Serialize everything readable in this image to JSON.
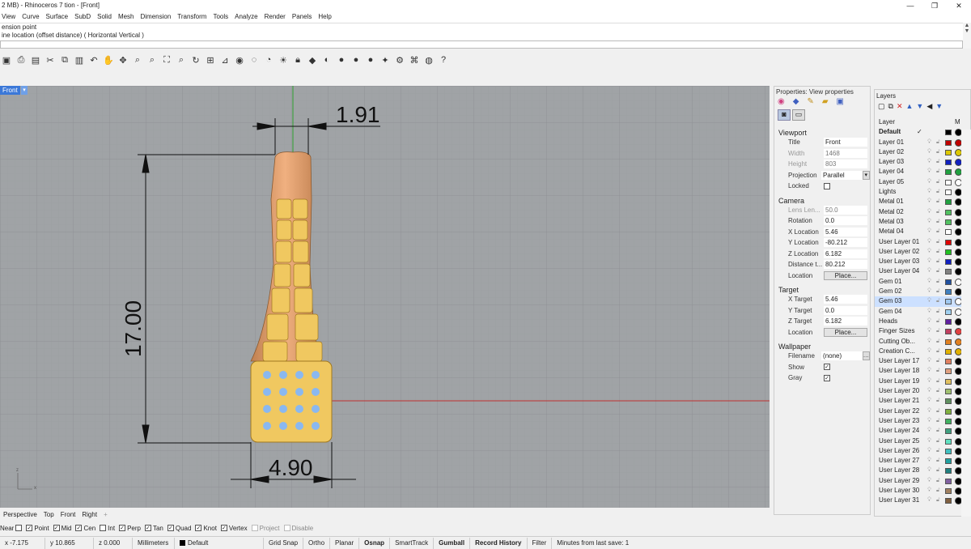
{
  "window": {
    "title": "2 MB) - Rhinoceros 7 tion - [Front]"
  },
  "menu": [
    "View",
    "Curve",
    "Surface",
    "SubD",
    "Solid",
    "Mesh",
    "Dimension",
    "Transform",
    "Tools",
    "Analyze",
    "Render",
    "Panels",
    "Help"
  ],
  "command": {
    "history": [
      "ension point",
      "ine location (offset distance) ( Horizontal  Vertical )"
    ],
    "prompt": ""
  },
  "viewport": {
    "name": "Front",
    "dims": {
      "top": "1.91",
      "height": "17.00",
      "bottom": "4.90"
    }
  },
  "viewport_tabs": [
    "Perspective",
    "Top",
    "Front",
    "Right"
  ],
  "osnap": [
    {
      "label": "Near",
      "checked": false
    },
    {
      "label": "Point",
      "checked": true
    },
    {
      "label": "Mid",
      "checked": true
    },
    {
      "label": "Cen",
      "checked": true
    },
    {
      "label": "Int",
      "checked": false
    },
    {
      "label": "Perp",
      "checked": true
    },
    {
      "label": "Tan",
      "checked": true
    },
    {
      "label": "Quad",
      "checked": true
    },
    {
      "label": "Knot",
      "checked": true
    },
    {
      "label": "Vertex",
      "checked": true
    },
    {
      "label": "Project",
      "checked": false
    },
    {
      "label": "Disable",
      "checked": false
    }
  ],
  "status": {
    "x": "x -7.175",
    "y": "y 10.865",
    "z": "z 0.000",
    "units": "Millimeters",
    "layer": "Default",
    "toggles": [
      "Grid Snap",
      "Ortho",
      "Planar",
      "Osnap",
      "SmartTrack",
      "Gumball",
      "Record History",
      "Filter"
    ],
    "bold_toggles": [
      "Osnap",
      "Gumball",
      "Record History"
    ],
    "save": "Minutes from last save: 1"
  },
  "properties": {
    "title": "Properties: View properties",
    "sections": {
      "viewport": {
        "heading": "Viewport",
        "rows": [
          {
            "label": "Title",
            "value": "Front"
          },
          {
            "label": "Width",
            "value": "1468",
            "grey": true
          },
          {
            "label": "Height",
            "value": "803",
            "grey": true
          },
          {
            "label": "Projection",
            "value": "Parallel"
          },
          {
            "label": "Locked",
            "value": ""
          }
        ]
      },
      "camera": {
        "heading": "Camera",
        "rows": [
          {
            "label": "Lens Len...",
            "value": "50.0",
            "grey": true
          },
          {
            "label": "Rotation",
            "value": "0.0"
          },
          {
            "label": "X Location",
            "value": "5.46"
          },
          {
            "label": "Y Location",
            "value": "-80.212"
          },
          {
            "label": "Z Location",
            "value": "6.182"
          },
          {
            "label": "Distance t...",
            "value": "80.212"
          },
          {
            "label": "Location",
            "value": "Place...",
            "button": true
          }
        ]
      },
      "target": {
        "heading": "Target",
        "rows": [
          {
            "label": "X Target",
            "value": "5.46"
          },
          {
            "label": "Y Target",
            "value": "0.0"
          },
          {
            "label": "Z Target",
            "value": "6.182"
          },
          {
            "label": "Location",
            "value": "Place...",
            "button": true
          }
        ]
      },
      "wallpaper": {
        "heading": "Wallpaper",
        "rows": [
          {
            "label": "Filename",
            "value": "(none)"
          },
          {
            "label": "Show",
            "value": "✓"
          },
          {
            "label": "Gray",
            "value": "✓"
          }
        ]
      }
    }
  },
  "layers": {
    "title": "Layers",
    "header": "Layer",
    "items": [
      {
        "name": "Default",
        "color": "#000000",
        "mat": "#000000",
        "bold": true,
        "current": true
      },
      {
        "name": "Layer 01",
        "color": "#c00000",
        "mat": "#c00000"
      },
      {
        "name": "Layer 02",
        "color": "#ddc800",
        "mat": "#ddc800"
      },
      {
        "name": "Layer 03",
        "color": "#1020c0",
        "mat": "#1020c0"
      },
      {
        "name": "Layer 04",
        "color": "#20a040",
        "mat": "#20a040"
      },
      {
        "name": "Layer 05",
        "color": "#ffffff",
        "mat": "#ffffff"
      },
      {
        "name": "Lights",
        "color": "#ffffff",
        "mat": "#000000"
      },
      {
        "name": "Metal 01",
        "color": "#20a040",
        "mat": "#000000"
      },
      {
        "name": "Metal 02",
        "color": "#50c060",
        "mat": "#000000"
      },
      {
        "name": "Metal 03",
        "color": "#50c060",
        "mat": "#000000"
      },
      {
        "name": "Metal 04",
        "color": "#ffffff",
        "mat": "#000000"
      },
      {
        "name": "User Layer 01",
        "color": "#e00000",
        "mat": "#000000"
      },
      {
        "name": "User Layer 02",
        "color": "#20c020",
        "mat": "#000000"
      },
      {
        "name": "User Layer 03",
        "color": "#1020c0",
        "mat": "#000000"
      },
      {
        "name": "User Layer 04",
        "color": "#808080",
        "mat": "#000000"
      },
      {
        "name": "Gem 01",
        "color": "#2050a0",
        "mat": "#ffffff"
      },
      {
        "name": "Gem 02",
        "color": "#4080c0",
        "mat": "#000000"
      },
      {
        "name": "Gem 03",
        "color": "#a0c8f0",
        "mat": "#ffffff",
        "selected": true
      },
      {
        "name": "Gem 04",
        "color": "#a0d0f0",
        "mat": "#ffffff"
      },
      {
        "name": "Heads",
        "color": "#6020a0",
        "mat": "#000000"
      },
      {
        "name": "Finger Sizes",
        "color": "#c04060",
        "mat": "#e04040"
      },
      {
        "name": "Cutting Ob...",
        "color": "#e08020",
        "mat": "#e08020"
      },
      {
        "name": "Creation C...",
        "color": "#e0b000",
        "mat": "#e0b000"
      },
      {
        "name": "User Layer 17",
        "color": "#e08060",
        "mat": "#000000"
      },
      {
        "name": "User Layer 18",
        "color": "#e0a080",
        "mat": "#000000"
      },
      {
        "name": "User Layer 19",
        "color": "#e0c060",
        "mat": "#000000"
      },
      {
        "name": "User Layer 20",
        "color": "#a0c070",
        "mat": "#000000"
      },
      {
        "name": "User Layer 21",
        "color": "#609060",
        "mat": "#000000"
      },
      {
        "name": "User Layer 22",
        "color": "#80b040",
        "mat": "#000000"
      },
      {
        "name": "User Layer 23",
        "color": "#40b060",
        "mat": "#000000"
      },
      {
        "name": "User Layer 24",
        "color": "#40a080",
        "mat": "#000000"
      },
      {
        "name": "User Layer 25",
        "color": "#60e0c0",
        "mat": "#000000"
      },
      {
        "name": "User Layer 26",
        "color": "#40c0c0",
        "mat": "#000000"
      },
      {
        "name": "User Layer 27",
        "color": "#20a0a0",
        "mat": "#000000"
      },
      {
        "name": "User Layer 28",
        "color": "#208080",
        "mat": "#000000"
      },
      {
        "name": "User Layer 29",
        "color": "#8060a0",
        "mat": "#000000"
      },
      {
        "name": "User Layer 30",
        "color": "#a08060",
        "mat": "#000000"
      },
      {
        "name": "User Layer 31",
        "color": "#806040",
        "mat": "#000000"
      }
    ]
  },
  "colors": {
    "viewport_bg": "#a0a3a6",
    "grid": "#8f9295",
    "x_axis": "#c03030",
    "y_axis": "#30a030",
    "tab_active": "#3b78d8",
    "gold": "#e8c060",
    "copper": "#e0a070",
    "gem": "#8ab8f0"
  }
}
